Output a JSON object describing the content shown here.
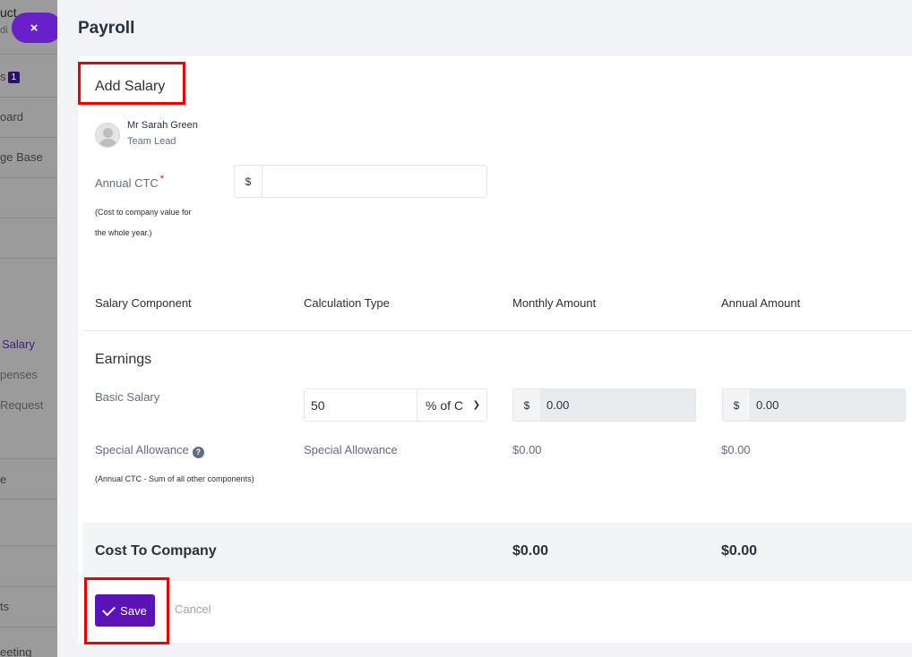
{
  "sidebar": {
    "items": [
      {
        "label": "uct"
      },
      {
        "label": "di"
      },
      {
        "label": "s",
        "badge": "1"
      },
      {
        "label": "oard"
      },
      {
        "label": "ge Base"
      },
      {
        "label": "Salary"
      },
      {
        "label": "penses"
      },
      {
        "label": "Request"
      },
      {
        "label": "e"
      },
      {
        "label": "ts"
      },
      {
        "label": "eeting"
      }
    ],
    "close_glyph": "×"
  },
  "page": {
    "title": "Payroll"
  },
  "form": {
    "section_title": "Add Salary",
    "employee": {
      "name": "Mr Sarah Green",
      "role": "Team Lead"
    },
    "annual_ctc": {
      "label": "Annual CTC",
      "required_mark": "*",
      "hint_line1": "(Cost to company value for",
      "hint_line2": "the whole year.)",
      "prefix": "$",
      "value": ""
    },
    "columns": [
      "Salary Component",
      "Calculation Type",
      "Monthly Amount",
      "Annual Amount"
    ],
    "earnings_title": "Earnings",
    "basic_salary": {
      "label": "Basic Salary",
      "value": "50",
      "calc_type": "% of C",
      "monthly_prefix": "$",
      "monthly": "0.00",
      "annual_prefix": "$",
      "annual": "0.00"
    },
    "special_allowance": {
      "label": "Special Allowance",
      "help_glyph": "?",
      "calc_type": "Special Allowance",
      "monthly": "$0.00",
      "annual": "$0.00",
      "hint": "(Annual CTC - Sum of all other components)"
    },
    "cost_to_company": {
      "label": "Cost To Company",
      "monthly": "$0.00",
      "annual": "$0.00"
    },
    "save_label": "Save",
    "cancel_label": "Cancel"
  },
  "colors": {
    "accent": "#5b13b8",
    "highlight": "#ee0000"
  }
}
